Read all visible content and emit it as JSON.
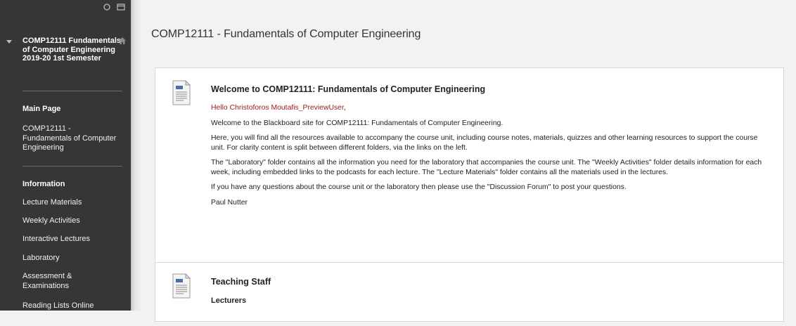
{
  "sidebar": {
    "course_title": "COMP12111 Fundamentals of Computer Engineering 2019-20 1st Semester",
    "main_heading": "Main Page",
    "main_link": "COMP12111 - Fundamentals of Computer Engineering",
    "info_heading": "Information",
    "links": [
      "Lecture Materials",
      "Weekly Activities",
      "Interactive Lectures",
      "Laboratory",
      "Assessment & Examinations",
      "Reading Lists Online"
    ],
    "tools": [
      "refresh-icon",
      "folder-icon"
    ]
  },
  "main": {
    "page_title": "COMP12111 - Fundamentals of Computer Engineering",
    "items": [
      {
        "title": "Welcome to COMP12111: Fundamentals of Computer Engineering",
        "greeting": "Hello Christoforos Moutafis_PreviewUser",
        "greeting_punct": ",",
        "paragraphs": [
          "Welcome to the Blackboard site for COMP12111: Fundamentals of Computer Engineering.",
          "Here, you will find all the resources available to accompany the course unit, including course notes, materials, quizzes and other learning resources to support the course unit. For clarity content is split between different folders, via the links on the left.",
          "The \"Laboratory\" folder contains all the information you need for the laboratory that accompanies the course unit. The \"Weekly Activities\" folder details information for each week, including embedded links to the podcasts for each lecture.  The \"Lecture Materials\" folder contains all the materials used in the lectures.",
          "If you have any questions about the course unit or the laboratory then please use the \"Discussion Forum\" to post your questions.",
          "Paul Nutter"
        ]
      },
      {
        "title": "Teaching Staff",
        "sub_heading": "Lecturers"
      }
    ],
    "icon_name": "document-icon"
  },
  "colors": {
    "sidebar_bg": "#363636",
    "greeting": "#9b1c1c",
    "page_bg": "#f2f2f2"
  }
}
